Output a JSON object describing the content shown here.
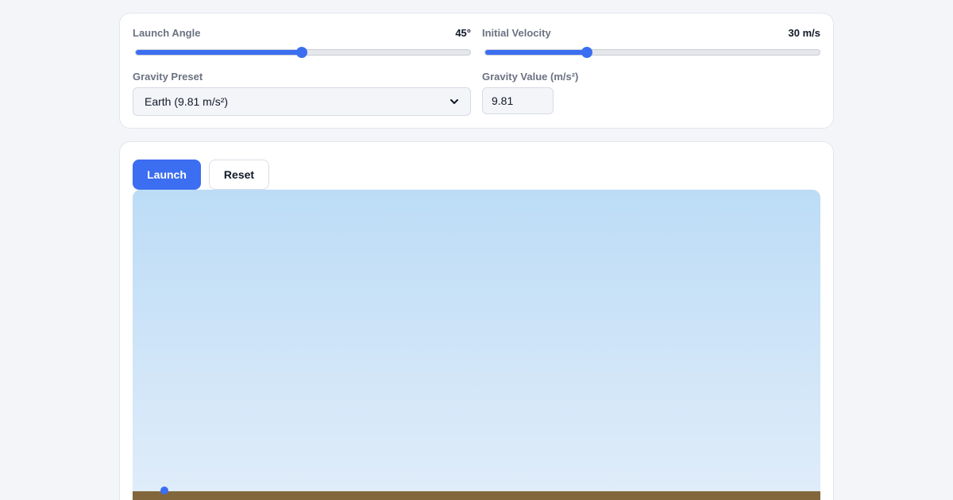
{
  "controls": {
    "launch_angle": {
      "label": "Launch Angle",
      "value_text": "45°",
      "value": 45,
      "min": 0,
      "max": 90
    },
    "initial_velocity": {
      "label": "Initial Velocity",
      "value_text": "30 m/s",
      "value": 30,
      "min": 0,
      "max": 100
    },
    "gravity_preset": {
      "label": "Gravity Preset",
      "selected": "Earth (9.81 m/s²)",
      "icon": "chevron-down-icon"
    },
    "gravity_value": {
      "label": "Gravity Value (m/s²)",
      "value": "9.81"
    }
  },
  "actions": {
    "launch_label": "Launch",
    "reset_label": "Reset"
  },
  "colors": {
    "accent": "#3b6ef0",
    "sky_top": "#bcdcf6",
    "sky_bottom": "#e3eefa",
    "ground": "#82673c"
  }
}
